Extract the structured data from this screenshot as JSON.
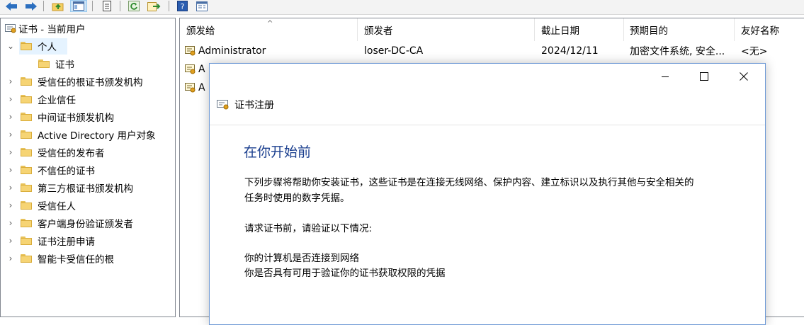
{
  "toolbar": {
    "buttons": [
      {
        "name": "back-button",
        "icon": "arrow-left-icon"
      },
      {
        "name": "forward-button",
        "icon": "arrow-right-icon"
      },
      {
        "name": "up-folder-button",
        "icon": "folder-up-icon"
      },
      {
        "name": "show-hide-tree-button",
        "icon": "console-tree-icon"
      },
      {
        "name": "export-list-button",
        "icon": "document-icon"
      },
      {
        "name": "refresh-button",
        "icon": "refresh-icon"
      },
      {
        "name": "export-button",
        "icon": "export-icon"
      },
      {
        "name": "help-button",
        "icon": "help-icon"
      },
      {
        "name": "properties-button",
        "icon": "properties-icon"
      }
    ]
  },
  "tree": {
    "root_label": "证书 - 当前用户",
    "items": [
      {
        "label": "个人",
        "expanded": true,
        "selected": true
      },
      {
        "label": "证书",
        "child": true
      },
      {
        "label": "受信任的根证书颁发机构"
      },
      {
        "label": "企业信任"
      },
      {
        "label": "中间证书颁发机构"
      },
      {
        "label": "Active Directory 用户对象"
      },
      {
        "label": "受信任的发布者"
      },
      {
        "label": "不信任的证书"
      },
      {
        "label": "第三方根证书颁发机构"
      },
      {
        "label": "受信任人"
      },
      {
        "label": "客户端身份验证颁发者"
      },
      {
        "label": "证书注册申请"
      },
      {
        "label": "智能卡受信任的根"
      }
    ]
  },
  "list": {
    "columns": [
      "颁发给",
      "颁发者",
      "截止日期",
      "预期目的",
      "友好名称"
    ],
    "rows": [
      {
        "issued_to": "Administrator",
        "issuer": "loser-DC-CA",
        "expires": "2024/12/11",
        "purpose": "加密文件系统, 安全...",
        "friendly": "<无>"
      },
      {
        "issued_to": "A"
      },
      {
        "issued_to": "A"
      }
    ]
  },
  "dialog": {
    "title": "证书注册",
    "heading": "在你开始前",
    "para1_line1": "下列步骤将帮助你安装证书，这些证书是在连接无线网络、保护内容、建立标识以及执行其他与安全相关的",
    "para1_line2": "任务时使用的数字凭据。",
    "para2": "请求证书前，请验证以下情况:",
    "check1": "你的计算机是否连接到网络",
    "check2": "你是否具有可用于验证你的证书获取权限的凭据",
    "buttons": {
      "minimize": "minimize-icon",
      "maximize": "maximize-icon",
      "close": "close-icon"
    }
  },
  "colors": {
    "accent": "#1a3e8e",
    "selection": "#e5f3ff",
    "folder": "#f6d474"
  }
}
